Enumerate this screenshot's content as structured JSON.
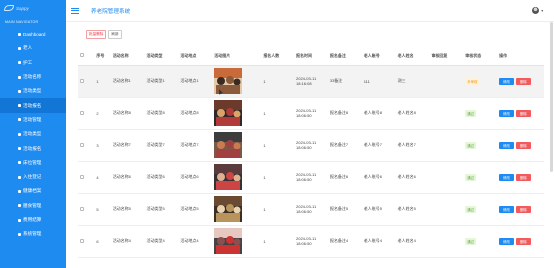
{
  "logo_text": "Sappy",
  "sidebar": {
    "nav_title": "MAIN NAVIGATOR",
    "items": [
      {
        "label": "Dashboard",
        "active": false
      },
      {
        "label": "老人",
        "active": false
      },
      {
        "label": "护工",
        "active": false
      },
      {
        "label": "活动名称",
        "active": false
      },
      {
        "label": "活动类型",
        "active": false
      },
      {
        "label": "活动报名",
        "active": true
      },
      {
        "label": "活动管理",
        "active": false
      },
      {
        "label": "活动类型",
        "active": false
      },
      {
        "label": "活动报名",
        "active": false
      },
      {
        "label": "床位管理",
        "active": false
      },
      {
        "label": "入住登记",
        "active": false
      },
      {
        "label": "健康档案",
        "active": false
      },
      {
        "label": "膳食管理",
        "active": false
      },
      {
        "label": "费用结算",
        "active": false
      },
      {
        "label": "系统管理",
        "active": false
      }
    ]
  },
  "header": {
    "title": "养老院管理系统"
  },
  "toolbar": {
    "batch_delete": "批量删除",
    "refresh": "刷新"
  },
  "table": {
    "columns": [
      "",
      "序号",
      "活动名称",
      "活动类型",
      "活动地点",
      "活动图片",
      "报名人数",
      "报名时间",
      "报名备注",
      "老人账号",
      "老人姓名",
      "审核回复",
      "审核状态",
      "操作"
    ],
    "rows": [
      {
        "index": "1",
        "name": "活动名称1",
        "type": "活动类型1",
        "place": "活动地点1",
        "count": "1",
        "time": "2024-03-11 18:16:08",
        "note": "33备注",
        "account": "111",
        "person": "测三",
        "reply": "",
        "status": "未审核",
        "status_kind": "pending",
        "img": "img1"
      },
      {
        "index": "2",
        "name": "活动名称8",
        "type": "活动类型8",
        "place": "活动地点8",
        "count": "1",
        "time": "2024-03-11 18:06:50",
        "note": "报名备注8",
        "account": "老人账号8",
        "person": "老人姓名8",
        "reply": "",
        "status": "通过",
        "status_kind": "pass",
        "img": "img2"
      },
      {
        "index": "3",
        "name": "活动名称7",
        "type": "活动类型7",
        "place": "活动地点7",
        "count": "1",
        "time": "2024-03-11 18:06:50",
        "note": "报名备注7",
        "account": "老人账号7",
        "person": "老人姓名7",
        "reply": "",
        "status": "通过",
        "status_kind": "pass",
        "img": "img3"
      },
      {
        "index": "4",
        "name": "活动名称6",
        "type": "活动类型6",
        "place": "活动地点6",
        "count": "1",
        "time": "2024-03-11 18:06:50",
        "note": "报名备注6",
        "account": "老人账号6",
        "person": "老人姓名6",
        "reply": "",
        "status": "通过",
        "status_kind": "pass",
        "img": "img4"
      },
      {
        "index": "5",
        "name": "活动名称5",
        "type": "活动类型5",
        "place": "活动地点5",
        "count": "1",
        "time": "2024-03-11 18:06:50",
        "note": "报名备注5",
        "account": "老人账号5",
        "person": "老人姓名5",
        "reply": "",
        "status": "通过",
        "status_kind": "pass",
        "img": "img5"
      },
      {
        "index": "6",
        "name": "活动名称4",
        "type": "活动类型4",
        "place": "活动地点4",
        "count": "1",
        "time": "2024-03-11 18:06:50",
        "note": "报名备注4",
        "account": "老人账号4",
        "person": "老人姓名4",
        "reply": "",
        "status": "通过",
        "status_kind": "pass",
        "img": "img6"
      }
    ],
    "edit_label": "修改",
    "delete_label": "删除"
  },
  "colors": {
    "brand": "#1e8bf0",
    "danger": "#f25b5b",
    "pass": "#5aa537",
    "pending": "#e69a1f"
  }
}
